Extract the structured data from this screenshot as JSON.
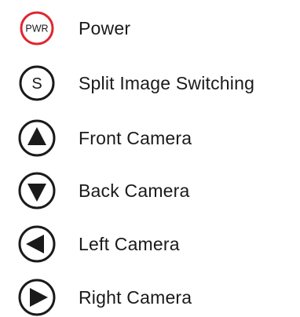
{
  "colors": {
    "power_ring": "#e0262f",
    "ink": "#1a1a1a"
  },
  "legend": {
    "items": [
      {
        "icon": "power-icon",
        "glyph": "PWR",
        "label": "Power"
      },
      {
        "icon": "split-switch-icon",
        "glyph": "S",
        "label": "Split Image Switching"
      },
      {
        "icon": "up-arrow-icon",
        "label": "Front Camera"
      },
      {
        "icon": "down-arrow-icon",
        "label": "Back Camera"
      },
      {
        "icon": "left-arrow-icon",
        "label": "Left Camera"
      },
      {
        "icon": "right-arrow-icon",
        "label": "Right Camera"
      }
    ]
  }
}
